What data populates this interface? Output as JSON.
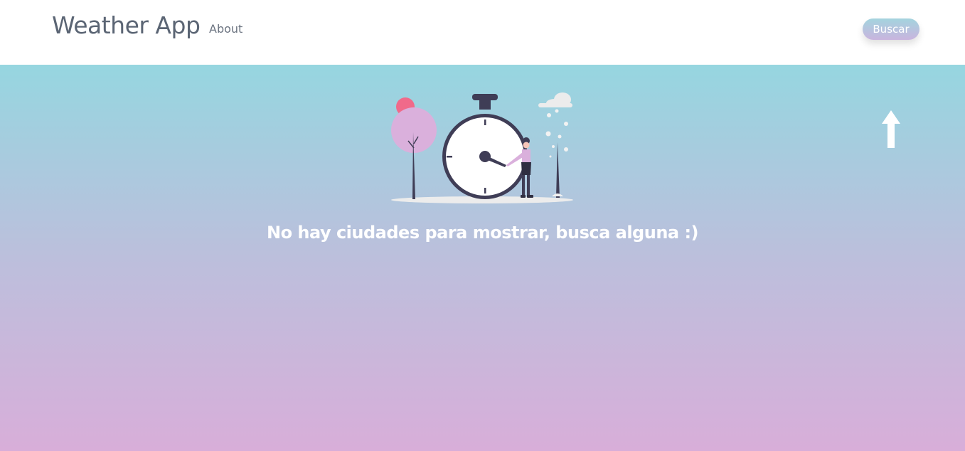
{
  "navbar": {
    "brand": "Weather App",
    "about_label": "About",
    "search_label": "Buscar"
  },
  "main": {
    "empty_message": "No hay ciudades para mostrar, busca alguna :)"
  },
  "icons": {
    "illustration": "stopwatch-illustration",
    "scroll_up": "arrow-up-icon"
  },
  "colors": {
    "brand_text": "#5b6574",
    "gradient_top": "#96d6e0",
    "gradient_bottom": "#d8aed9",
    "accent_pink": "#f06a8a",
    "accent_lilac": "#dab0dc",
    "dark_navy": "#3f3d56"
  }
}
